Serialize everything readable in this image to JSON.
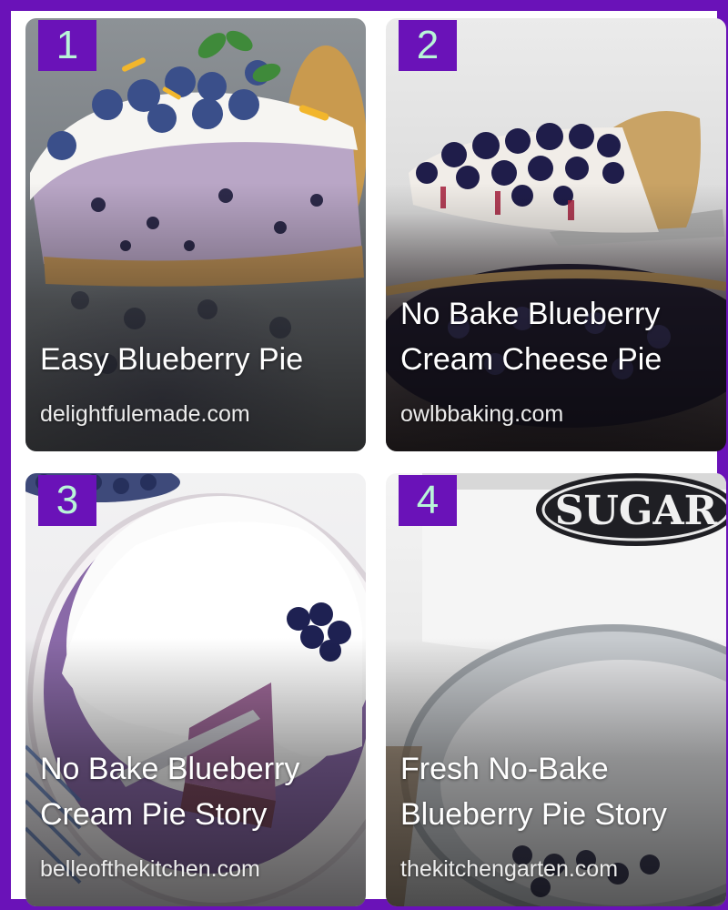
{
  "cards": [
    {
      "number": "1",
      "title": "Easy Blueberry Pie",
      "source": "delightfulemade.com"
    },
    {
      "number": "2",
      "title": "No Bake Blueberry Cream Cheese Pie",
      "source": "owlbbaking.com"
    },
    {
      "number": "3",
      "title": "No Bake Blueberry Cream Pie Story",
      "source": "belleofthekitchen.com"
    },
    {
      "number": "4",
      "title": "Fresh No-Bake Blueberry Pie Story",
      "source": "thekitchengarten.com"
    }
  ],
  "photo_text": {
    "jar_label": "SUGAR"
  },
  "colors": {
    "frame": "#6a12b8",
    "badge_bg": "#6a12b8",
    "badge_text": "#b9f5d8",
    "title_text": "#ffffff"
  }
}
